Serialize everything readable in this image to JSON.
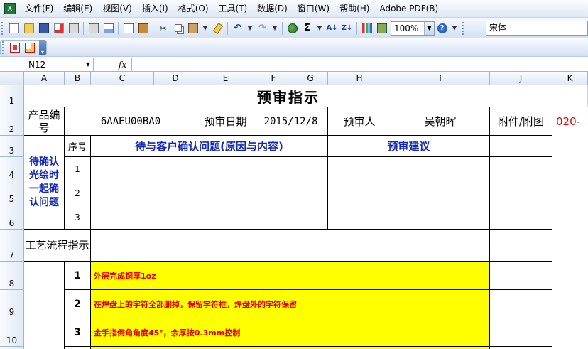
{
  "menu": {
    "items": [
      "文件(F)",
      "编辑(E)",
      "视图(V)",
      "插入(I)",
      "格式(O)",
      "工具(T)",
      "数据(D)",
      "窗口(W)",
      "帮助(H)",
      "Adobe PDF(B)"
    ]
  },
  "toolbar": {
    "zoom_value": "100%",
    "font_name": "宋体",
    "sum_glyph": "Σ",
    "undo_glyph": "↶",
    "redo_glyph": "↷"
  },
  "formula_bar": {
    "name_box": "N12",
    "fx_label": "fx",
    "content": ""
  },
  "sheet": {
    "columns": [
      "A",
      "B",
      "C",
      "D",
      "E",
      "F",
      "G",
      "H",
      "I",
      "J",
      "K"
    ],
    "rows": [
      "1",
      "2",
      "3",
      "4",
      "5",
      "6",
      "7",
      "8",
      "9",
      "10"
    ],
    "title": "预审指示",
    "product_label": "产品编号",
    "product_code": "6AAEU00BA0",
    "date_label": "预审日期",
    "date_value": "2015/12/8",
    "reviewer_label": "预审人",
    "reviewer_name": "吴朝晖",
    "attachment_label": "附件/附图",
    "overflow_text": "020-",
    "pending_label": "待确认光绘时一起确认问题",
    "seq_label": "序号",
    "issue_header": "待与客户确认问题(原因与内容)",
    "advice_header": "预审建议",
    "issue_numbers": [
      "1",
      "2",
      "3"
    ],
    "process_label": "工艺流程指示",
    "steps": [
      {
        "num": "1",
        "text": "外层完成铜厚1oz"
      },
      {
        "num": "2",
        "text": "在焊盘上的字符全部删掉，保留字符框，焊盘外的字符保留"
      },
      {
        "num": "3",
        "text": "金手指倒角角度45°，余厚按0.3mm控制"
      }
    ]
  },
  "colors": {
    "highlight": "#ffff00",
    "red_text": "#e40000",
    "blue_text": "#1428b8"
  }
}
